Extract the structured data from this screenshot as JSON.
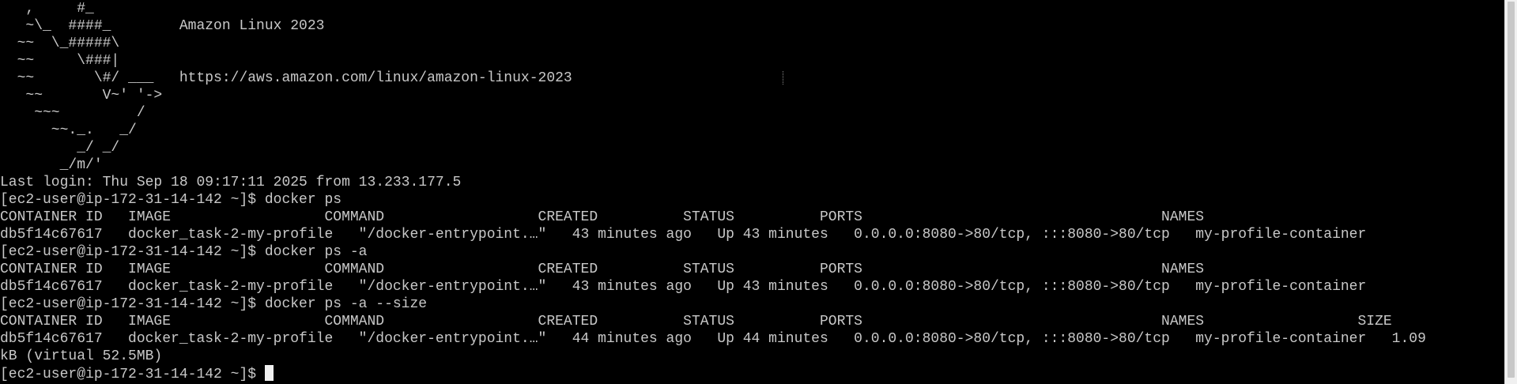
{
  "terminal": {
    "lines": [
      "   ,     #_",
      "   ~\\_  ####_        Amazon Linux 2023",
      "  ~~  \\_#####\\",
      "  ~~     \\###|",
      "  ~~       \\#/ ___   https://aws.amazon.com/linux/amazon-linux-2023",
      "   ~~       V~' '->",
      "    ~~~         /",
      "      ~~._.   _/",
      "         _/ _/",
      "       _/m/'",
      "Last login: Thu Sep 18 09:17:11 2025 from 13.233.177.5",
      "[ec2-user@ip-172-31-14-142 ~]$ docker ps",
      "CONTAINER ID   IMAGE                  COMMAND                  CREATED          STATUS          PORTS                                   NAMES",
      "db5f14c67617   docker_task-2-my-profile   \"/docker-entrypoint.…\"   43 minutes ago   Up 43 minutes   0.0.0.0:8080->80/tcp, :::8080->80/tcp   my-profile-container",
      "[ec2-user@ip-172-31-14-142 ~]$ docker ps -a",
      "CONTAINER ID   IMAGE                  COMMAND                  CREATED          STATUS          PORTS                                   NAMES",
      "db5f14c67617   docker_task-2-my-profile   \"/docker-entrypoint.…\"   43 minutes ago   Up 43 minutes   0.0.0.0:8080->80/tcp, :::8080->80/tcp   my-profile-container",
      "[ec2-user@ip-172-31-14-142 ~]$ docker ps -a --size",
      "CONTAINER ID   IMAGE                  COMMAND                  CREATED          STATUS          PORTS                                   NAMES                  SIZE",
      "db5f14c67617   docker_task-2-my-profile   \"/docker-entrypoint.…\"   44 minutes ago   Up 44 minutes   0.0.0.0:8080->80/tcp, :::8080->80/tcp   my-profile-container   1.09",
      "kB (virtual 52.5MB)"
    ],
    "prompt": "[ec2-user@ip-172-31-14-142 ~]$ "
  }
}
